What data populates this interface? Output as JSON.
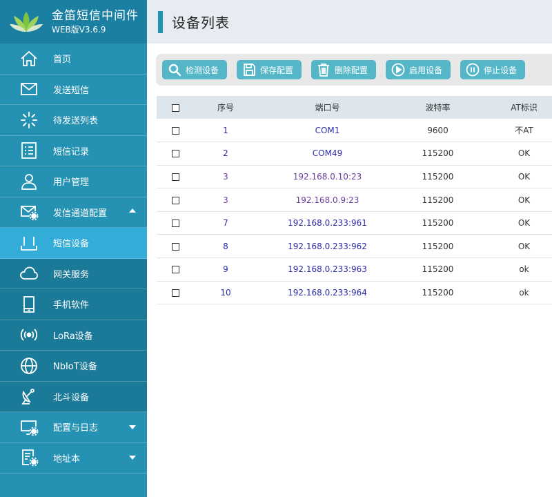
{
  "brand": {
    "title": "金笛短信中间件",
    "version": "WEB版V3.6.9"
  },
  "sidebar": {
    "items": [
      {
        "label": "首页",
        "icon": "home-icon"
      },
      {
        "label": "发送短信",
        "icon": "envelope-icon"
      },
      {
        "label": "待发送列表",
        "icon": "loading-icon"
      },
      {
        "label": "短信记录",
        "icon": "list-icon"
      },
      {
        "label": "用户管理",
        "icon": "user-icon"
      },
      {
        "label": "发信通道配置",
        "icon": "mail-gear-icon",
        "expanded": true
      },
      {
        "label": "短信设备",
        "icon": "router-icon",
        "active": true
      },
      {
        "label": "网关服务",
        "icon": "cloud-icon"
      },
      {
        "label": "手机软件",
        "icon": "phone-icon"
      },
      {
        "label": "LoRa设备",
        "icon": "signal-icon"
      },
      {
        "label": "NbIoT设备",
        "icon": "globe-icon"
      },
      {
        "label": "北斗设备",
        "icon": "satellite-dish-icon"
      },
      {
        "label": "配置与日志",
        "icon": "monitor-gear-icon",
        "expanded": false
      },
      {
        "label": "地址本",
        "icon": "doc-gear-icon",
        "expanded": false
      }
    ]
  },
  "header": {
    "title": "设备列表"
  },
  "toolbar": {
    "buttons": [
      {
        "label": "检测设备",
        "icon": "search-icon"
      },
      {
        "label": "保存配置",
        "icon": "save-icon"
      },
      {
        "label": "删除配置",
        "icon": "trash-icon"
      },
      {
        "label": "启用设备",
        "icon": "play-icon"
      },
      {
        "label": "停止设备",
        "icon": "pause-icon"
      }
    ]
  },
  "table": {
    "columns": [
      "序号",
      "端口号",
      "波特率",
      "AT标识"
    ],
    "rows": [
      {
        "no": "1",
        "port": "COM1",
        "baud": "9600",
        "at": "不AT"
      },
      {
        "no": "2",
        "port": "COM49",
        "baud": "115200",
        "at": "OK"
      },
      {
        "no": "3",
        "port": "192.168.0.10:23",
        "baud": "115200",
        "at": "OK"
      },
      {
        "no": "3",
        "port": "192.168.0.9:23",
        "baud": "115200",
        "at": "OK"
      },
      {
        "no": "7",
        "port": "192.168.0.233:961",
        "baud": "115200",
        "at": "OK"
      },
      {
        "no": "8",
        "port": "192.168.0.233:962",
        "baud": "115200",
        "at": "OK"
      },
      {
        "no": "9",
        "port": "192.168.0.233:963",
        "baud": "115200",
        "at": "ok"
      },
      {
        "no": "10",
        "port": "192.168.0.233:964",
        "baud": "115200",
        "at": "ok"
      }
    ]
  },
  "colors": {
    "sidebar": "#2592b4",
    "sidebar_active": "#33acd8",
    "sidebar_sub": "#1c7a99",
    "button": "#54b6c7"
  }
}
